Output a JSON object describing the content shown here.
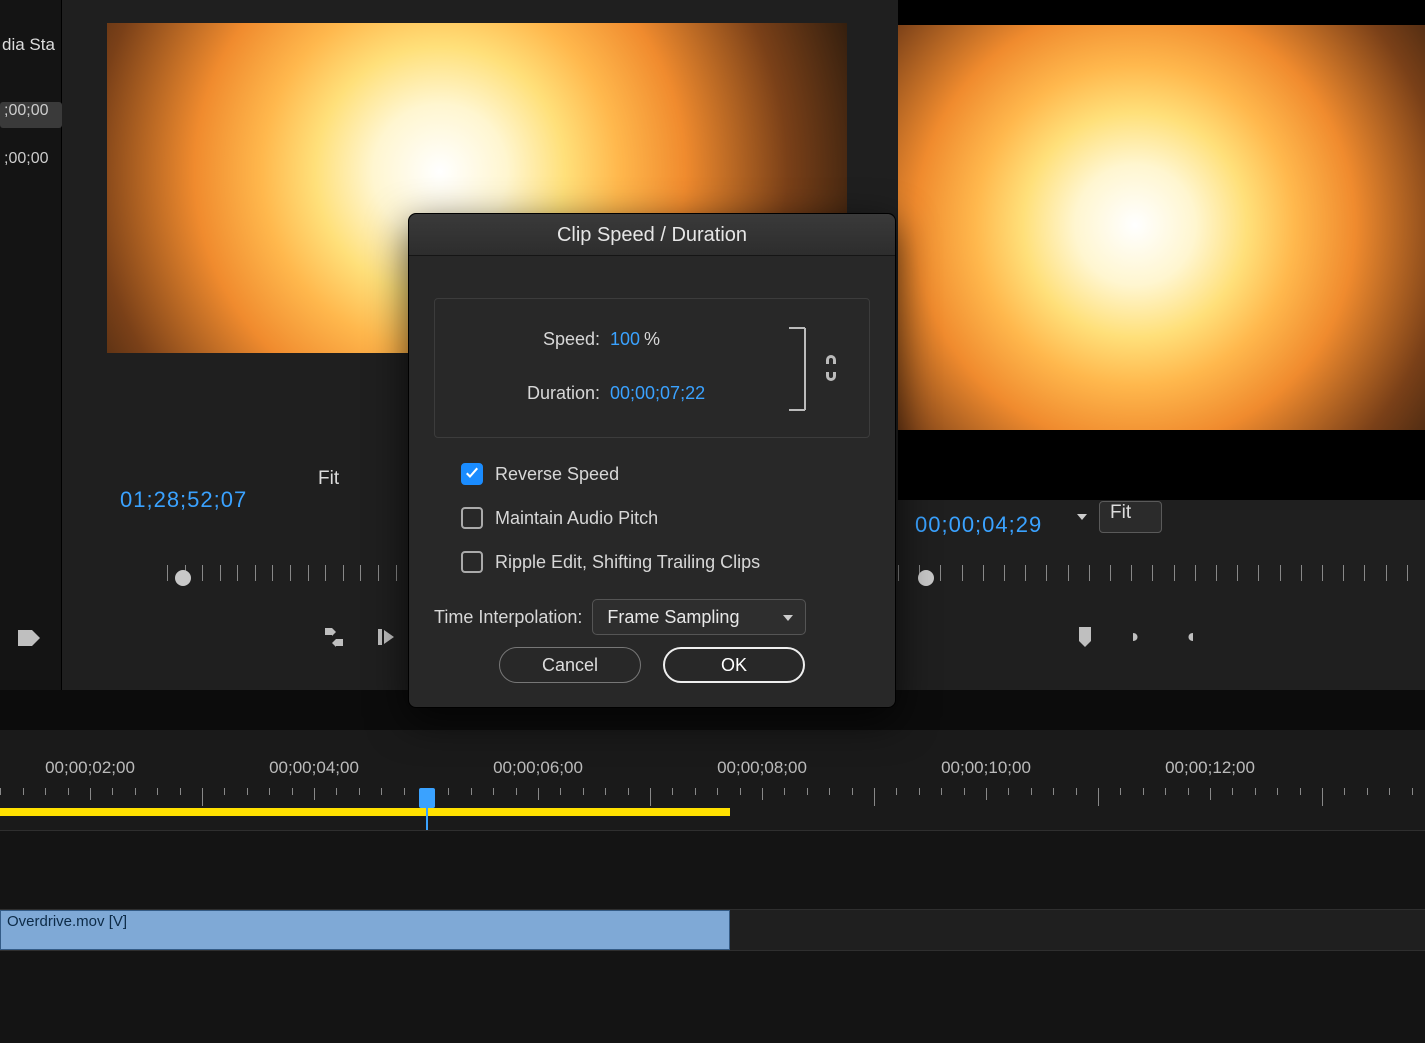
{
  "sidebar": {
    "tab_label": "dia Sta",
    "tc_top": ";00;00",
    "tc_bot": ";00;00"
  },
  "source": {
    "timecode": "01;28;52;07",
    "fit": "Fit"
  },
  "program": {
    "timecode": "00;00;04;29",
    "fit": "Fit"
  },
  "dialog": {
    "title": "Clip Speed / Duration",
    "speed_label": "Speed:",
    "speed_value": "100",
    "speed_unit": "%",
    "duration_label": "Duration:",
    "duration_value": "00;00;07;22",
    "reverse_label": "Reverse Speed",
    "reverse_checked": true,
    "pitch_label": "Maintain Audio Pitch",
    "pitch_checked": false,
    "ripple_label": "Ripple Edit, Shifting Trailing Clips",
    "ripple_checked": false,
    "interp_label": "Time Interpolation:",
    "interp_value": "Frame Sampling",
    "cancel": "Cancel",
    "ok": "OK"
  },
  "timeline": {
    "labels": [
      "00;00;02;00",
      "00;00;04;00",
      "00;00;06;00",
      "00;00;08;00",
      "00;00;10;00",
      "00;00;12;00"
    ],
    "clip_name": "Overdrive.mov [V]"
  }
}
